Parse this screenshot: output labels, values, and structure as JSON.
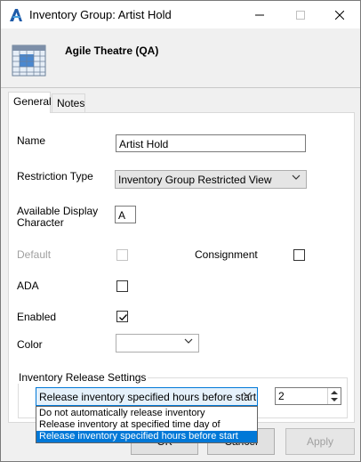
{
  "window": {
    "title": "Inventory Group: Artist Hold",
    "app_icon": "agile-a-logo",
    "controls": {
      "minimize": "—",
      "maximize": "☐",
      "close": "✕"
    }
  },
  "header": {
    "icon": "calendar-grid-icon",
    "app_name": "Agile Theatre (QA)"
  },
  "tabs": [
    {
      "label": "General",
      "active": true
    },
    {
      "label": "Notes",
      "active": false
    }
  ],
  "form": {
    "name": {
      "label": "Name",
      "value": "Artist Hold"
    },
    "restriction_type": {
      "label": "Restriction Type",
      "value": "Inventory Group Restricted View"
    },
    "display_character": {
      "label": "Available Display Character",
      "value": "A"
    },
    "default": {
      "label": "Default",
      "checked": false,
      "disabled": true
    },
    "consignment": {
      "label": "Consignment",
      "checked": false
    },
    "ada": {
      "label": "ADA",
      "checked": false
    },
    "enabled": {
      "label": "Enabled",
      "checked": true
    },
    "color": {
      "label": "Color",
      "value": ""
    }
  },
  "release_settings": {
    "title": "Inventory Release Settings",
    "mode_value": "Release inventory specified hours before start",
    "hours_value": "2",
    "options": [
      "Do not automatically release inventory",
      "Release inventory at specified time day of",
      "Release inventory specified hours before start"
    ],
    "selected_index": 2
  },
  "buttons": {
    "ok": "OK",
    "cancel": "Cancel",
    "apply": "Apply"
  },
  "colors": {
    "accent": "#0078d7",
    "logo_blue": "#1e5aa8"
  }
}
